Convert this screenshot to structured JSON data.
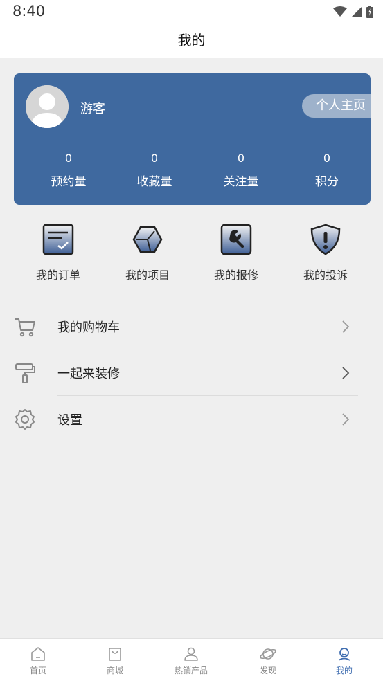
{
  "status_bar": {
    "time": "8:40"
  },
  "header": {
    "title": "我的"
  },
  "profile": {
    "username": "游客",
    "homepage_label": "个人主页",
    "stats": [
      {
        "value": "0",
        "label": "预约量"
      },
      {
        "value": "0",
        "label": "收藏量"
      },
      {
        "value": "0",
        "label": "关注量"
      },
      {
        "value": "0",
        "label": "积分"
      }
    ]
  },
  "actions": [
    {
      "label": "我的订单",
      "icon": "order-icon"
    },
    {
      "label": "我的项目",
      "icon": "project-icon"
    },
    {
      "label": "我的报修",
      "icon": "repair-icon"
    },
    {
      "label": "我的投诉",
      "icon": "complaint-icon"
    }
  ],
  "menu": [
    {
      "label": "我的购物车",
      "icon": "cart-icon"
    },
    {
      "label": "一起来装修",
      "icon": "paint-roller-icon"
    },
    {
      "label": "设置",
      "icon": "settings-icon"
    }
  ],
  "tabbar": {
    "tabs": [
      {
        "label": "首页",
        "icon": "home-icon"
      },
      {
        "label": "商城",
        "icon": "shopping-bag-icon"
      },
      {
        "label": "热销产品",
        "icon": "person-icon"
      },
      {
        "label": "发现",
        "icon": "planet-icon"
      },
      {
        "label": "我的",
        "icon": "profile-icon"
      }
    ],
    "active_index": 4
  },
  "colors": {
    "card_background": "#3f699f",
    "accent": "#3f6db0",
    "page_background": "#efefef"
  }
}
